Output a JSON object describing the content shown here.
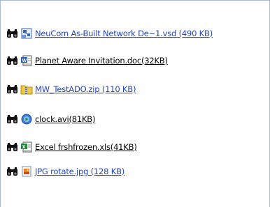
{
  "attachments": [
    {
      "label": "NeuCom As-Built Network De~1.vsd (490 KB)",
      "icon": "visio-file-icon",
      "color": "#2446b8"
    },
    {
      "label": "Planet Aware Invitation.doc(32KB)",
      "icon": "word-doc-icon",
      "color": "#000000"
    },
    {
      "label": "MW_TestADO.zip (110 KB)",
      "icon": "zip-folder-icon",
      "color": "#2446b8"
    },
    {
      "label": "clock.avi(81KB)",
      "icon": "video-file-icon",
      "color": "#000000"
    },
    {
      "label": "Excel frshfrozen.xls(41KB)",
      "icon": "excel-file-icon",
      "color": "#000000"
    },
    {
      "label": "JPG rotate.jpg (128 KB)",
      "icon": "image-file-icon",
      "color": "#2446b8"
    }
  ],
  "preview_icon": "binoculars-icon"
}
